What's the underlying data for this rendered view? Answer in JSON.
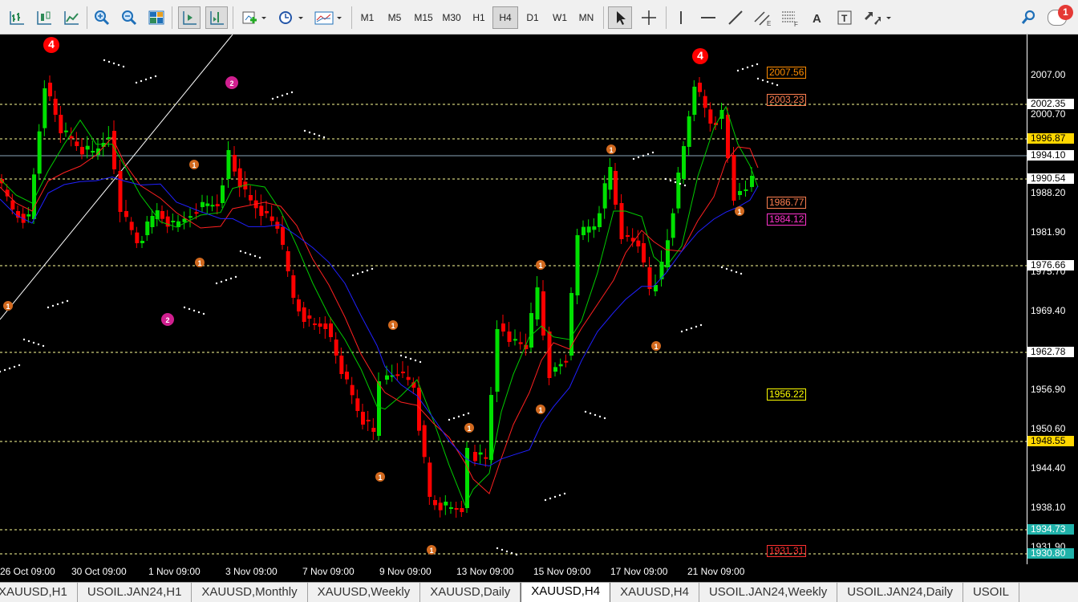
{
  "toolbar": {
    "timeframes": [
      "M1",
      "M5",
      "M15",
      "M30",
      "H1",
      "H4",
      "D1",
      "W1",
      "MN"
    ],
    "active_timeframe": "H4",
    "notification_count": "1",
    "icons": [
      "bar-chart-icon",
      "candlestick-chart-icon",
      "line-chart-icon",
      "zoom-in-icon",
      "zoom-out-icon",
      "tile-windows-icon",
      "auto-scroll-icon",
      "chart-shift-icon",
      "indicators-icon",
      "periods-clock-icon",
      "templates-icon",
      "cursor-icon",
      "crosshair-icon",
      "vertical-line-icon",
      "horizontal-line-icon",
      "trendline-icon",
      "equidistant-channel-icon",
      "fibonacci-icon",
      "text-icon",
      "text-label-icon",
      "arrows-icon",
      "search-icon",
      "notification-icon"
    ]
  },
  "price_axis": {
    "ticks": [
      "2007.00",
      "2000.70",
      "1994.10",
      "1988.20",
      "1981.90",
      "1975.70",
      "1969.40",
      "1962.78",
      "1956.90",
      "1950.60",
      "1944.40",
      "1938.10",
      "1931.90"
    ],
    "boxed": [
      {
        "text": "2002.35",
        "bg": "#ffffff",
        "fg": "#000000"
      },
      {
        "text": "1996.87",
        "bg": "#ffd700",
        "fg": "#000000"
      },
      {
        "text": "1994.10",
        "bg": "#ffffff",
        "fg": "#000000"
      },
      {
        "text": "1990.54",
        "bg": "#ffffff",
        "fg": "#000000"
      },
      {
        "text": "1976.66",
        "bg": "#ffffff",
        "fg": "#000000"
      },
      {
        "text": "1962.78",
        "bg": "#ffffff",
        "fg": "#000000"
      },
      {
        "text": "1948.55",
        "bg": "#ffd700",
        "fg": "#000000"
      },
      {
        "text": "1934.73",
        "bg": "#20b2aa",
        "fg": "#ffffff"
      },
      {
        "text": "1930.80",
        "bg": "#20b2aa",
        "fg": "#ffffff"
      }
    ]
  },
  "time_axis": [
    "26 Oct 09:00",
    "30 Oct 09:00",
    "1 Nov 09:00",
    "3 Nov 09:00",
    "7 Nov 09:00",
    "9 Nov 09:00",
    "13 Nov 09:00",
    "15 Nov 09:00",
    "17 Nov 09:00",
    "21 Nov 09:00"
  ],
  "level_labels": [
    {
      "text": "2007.56",
      "color": "#ff8c00"
    },
    {
      "text": "2003.23",
      "color": "#ff7f50"
    },
    {
      "text": "1986.77",
      "color": "#ff7f50"
    },
    {
      "text": "1984.12",
      "color": "#ff33cc"
    },
    {
      "text": "1956.22",
      "color": "#ffff00"
    },
    {
      "text": "1931.31",
      "color": "#ff3030"
    }
  ],
  "wave_markers": [
    {
      "label": "4",
      "color": "#ff0000"
    },
    {
      "label": "2",
      "color": "#d01f8f"
    },
    {
      "label": "1",
      "color": "#d2691e"
    },
    {
      "label": "4",
      "color": "#ff0000"
    }
  ],
  "chart_tabs": [
    "XAUUSD,H1",
    "USOIL.JAN24,H1",
    "XAUUSD,Monthly",
    "XAUUSD,Weekly",
    "XAUUSD,Daily",
    "XAUUSD,H4",
    "XAUUSD,H4",
    "USOIL.JAN24,Weekly",
    "USOIL.JAN24,Daily",
    "USOIL"
  ],
  "active_tab": "XAUUSD,H4",
  "colors": {
    "bull": "#00e000",
    "bear": "#ff0000",
    "grid": "#ffff99",
    "ma_fast": "#00cc00",
    "ma_mid": "#ff2020",
    "ma_slow": "#2020ff"
  }
}
